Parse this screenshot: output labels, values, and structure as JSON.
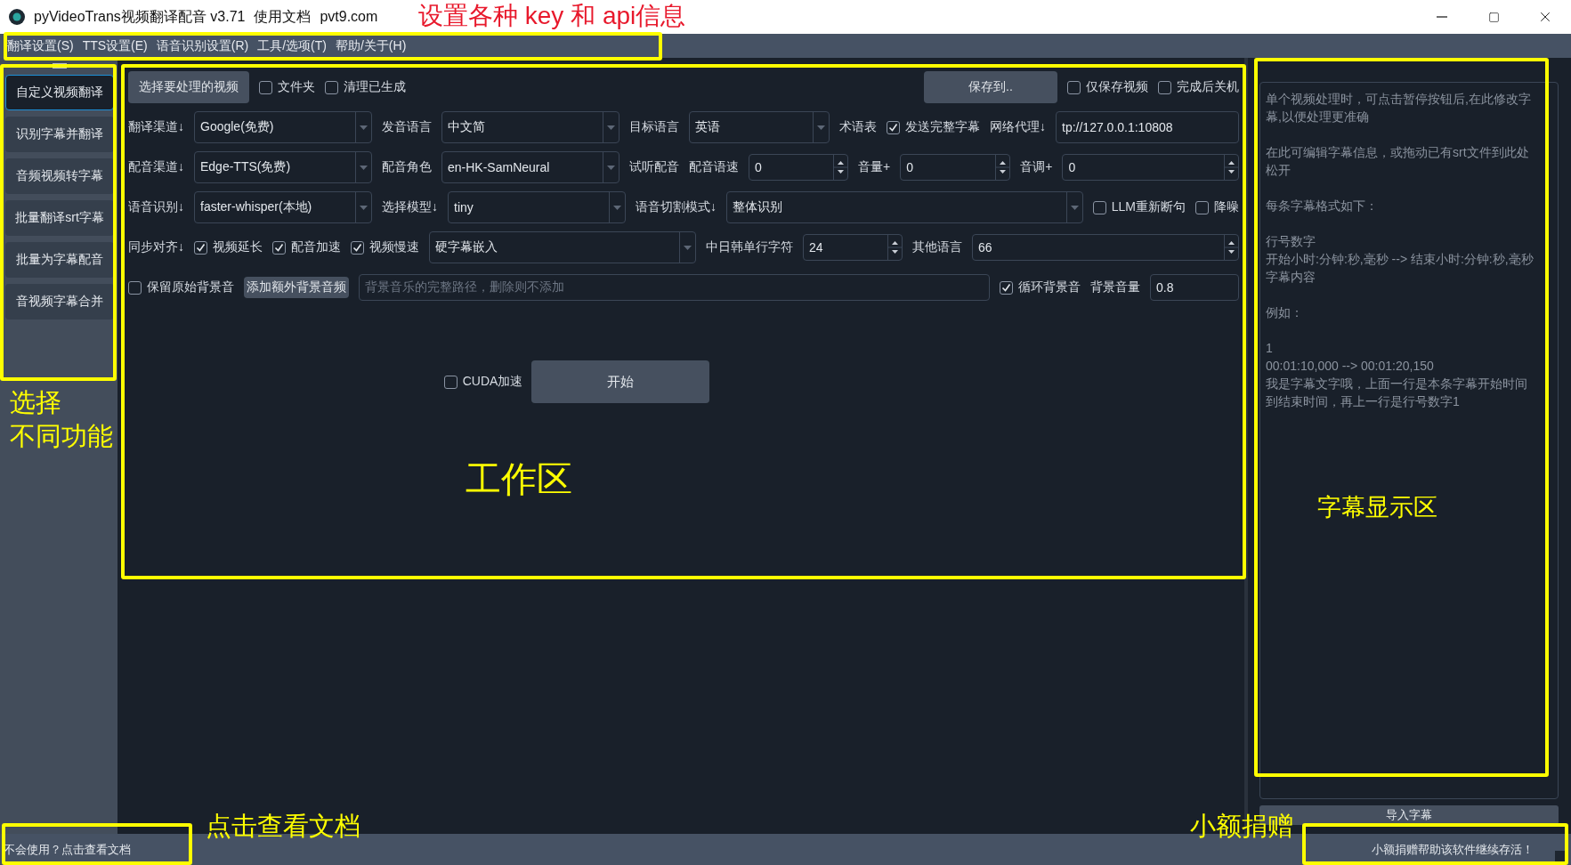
{
  "window": {
    "title": "pyVideoTrans视频翻译配音 v3.71",
    "links": [
      "使用文档",
      "pvt9.com"
    ]
  },
  "menu": [
    "翻译设置(S)",
    "TTS设置(E)",
    "语音识别设置(R)",
    "工具/选项(T)",
    "帮助/关于(H)"
  ],
  "sidebar": {
    "items": [
      {
        "label": "自定义视频翻译",
        "selected": true
      },
      {
        "label": "识别字幕并翻译",
        "selected": false
      },
      {
        "label": "音频视频转字幕",
        "selected": false
      },
      {
        "label": "批量翻译srt字幕",
        "selected": false
      },
      {
        "label": "批量为字幕配音",
        "selected": false
      },
      {
        "label": "音视频字幕合并",
        "selected": false
      }
    ]
  },
  "workspace": {
    "rows": [
      {
        "items": [
          {
            "kind": "button",
            "label": "选择要处理的视频"
          },
          {
            "kind": "checkbox",
            "label": "文件夹",
            "checked": false
          },
          {
            "kind": "checkbox",
            "label": "清理已生成",
            "checked": false
          },
          {
            "kind": "button",
            "label": "保存到.."
          },
          {
            "kind": "checkbox",
            "label": "仅保存视频",
            "checked": false
          },
          {
            "kind": "checkbox",
            "label": "完成后关机",
            "checked": false
          }
        ]
      },
      {
        "items": [
          {
            "kind": "label",
            "label": "翻译渠道↓"
          },
          {
            "kind": "select",
            "value": "Google(免费)"
          },
          {
            "kind": "label",
            "label": "发音语言"
          },
          {
            "kind": "select",
            "value": "中文简"
          },
          {
            "kind": "label",
            "label": "目标语言"
          },
          {
            "kind": "select",
            "value": "英语"
          },
          {
            "kind": "label",
            "label": "术语表"
          },
          {
            "kind": "checkbox",
            "label": "发送完整字幕",
            "checked": true
          },
          {
            "kind": "label",
            "label": "网络代理↓"
          },
          {
            "kind": "field",
            "value": "tp://127.0.0.1:10808"
          }
        ]
      },
      {
        "items": [
          {
            "kind": "label",
            "label": "配音渠道↓"
          },
          {
            "kind": "select",
            "value": "Edge-TTS(免费)"
          },
          {
            "kind": "label",
            "label": "配音角色"
          },
          {
            "kind": "select",
            "value": "en-HK-SamNeural"
          },
          {
            "kind": "label",
            "label": "试听配音"
          },
          {
            "kind": "label",
            "label": "配音语速"
          },
          {
            "kind": "spin",
            "value": "0"
          },
          {
            "kind": "label",
            "label": "音量+"
          },
          {
            "kind": "spin",
            "value": "0"
          },
          {
            "kind": "label",
            "label": "音调+"
          },
          {
            "kind": "spin",
            "value": "0"
          }
        ]
      },
      {
        "items": [
          {
            "kind": "label",
            "label": "语音识别↓"
          },
          {
            "kind": "select",
            "value": "faster-whisper(本地)"
          },
          {
            "kind": "label",
            "label": "选择模型↓"
          },
          {
            "kind": "select",
            "value": "tiny"
          },
          {
            "kind": "label",
            "label": "语音切割模式↓"
          },
          {
            "kind": "select",
            "value": "整体识别"
          },
          {
            "kind": "checkbox",
            "label": "LLM重新断句",
            "checked": false
          },
          {
            "kind": "checkbox",
            "label": "降噪",
            "checked": false
          }
        ]
      },
      {
        "items": [
          {
            "kind": "label",
            "label": "同步对齐↓"
          },
          {
            "kind": "checkbox",
            "label": "视频延长",
            "checked": true
          },
          {
            "kind": "checkbox",
            "label": "配音加速",
            "checked": true
          },
          {
            "kind": "checkbox",
            "label": "视频慢速",
            "checked": true
          },
          {
            "kind": "select",
            "value": "硬字幕嵌入"
          },
          {
            "kind": "label",
            "label": "中日韩单行字符"
          },
          {
            "kind": "spin",
            "value": "24"
          },
          {
            "kind": "label",
            "label": "其他语言"
          },
          {
            "kind": "spin",
            "value": "66"
          }
        ]
      },
      {
        "items": [
          {
            "kind": "checkbox",
            "label": "保留原始背景音",
            "checked": false
          },
          {
            "kind": "smallbutton",
            "label": "添加额外背景音频"
          },
          {
            "kind": "field",
            "placeholder": "背景音乐的完整路径，删除则不添加"
          },
          {
            "kind": "checkbox",
            "label": "循环背景音",
            "checked": true
          },
          {
            "kind": "label",
            "label": "背景音量"
          },
          {
            "kind": "field",
            "value": "0.8"
          }
        ]
      }
    ],
    "cuda": {
      "label": "CUDA加速",
      "checked": false
    },
    "start_button": "开始"
  },
  "subtitle_panel": {
    "placeholder_paragraphs": [
      [
        "单个视频处理时，可点击暂停按钮后,在此修改字幕,以便处理更准确"
      ],
      [
        "在此可编辑字幕信息，或拖动已有srt文件到此处松开"
      ],
      [
        "每条字幕格式如下："
      ],
      [
        "行号数字",
        "开始小时:分钟:秒,毫秒 --> 结束小时:分钟:秒,毫秒",
        "字幕内容"
      ],
      [
        "例如："
      ],
      [
        "1",
        "00:01:10,000 --> 00:01:20,150",
        "我是字幕文字哦，上面一行是本条字幕开始时间到结束时间，再上一行是行号数字1"
      ]
    ],
    "import_button": "导入字幕"
  },
  "status_bar": {
    "help_link": "不会使用？点击查看文档",
    "donate": "小额捐赠帮助该软件继续存活！"
  },
  "annotations": [
    {
      "text": "设置各种 key 和 api信息",
      "kind": "title"
    },
    {
      "text": "选择",
      "kind": "label"
    },
    {
      "text": "不同功能",
      "kind": "label"
    },
    {
      "text": "工作区",
      "kind": "label"
    },
    {
      "text": "字幕显示区",
      "kind": "label"
    },
    {
      "text": "点击查看文档",
      "kind": "label"
    },
    {
      "text": "小额捐赠",
      "kind": "label"
    }
  ]
}
